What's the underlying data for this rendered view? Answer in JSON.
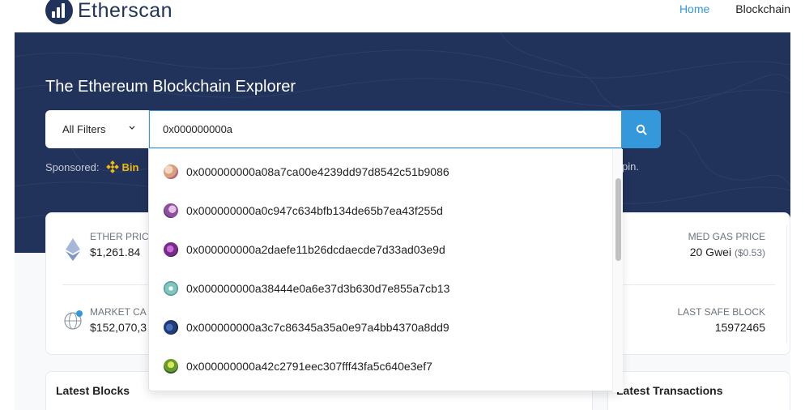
{
  "header": {
    "logo_text": "Etherscan",
    "nav": [
      {
        "label": "Home",
        "active": true
      },
      {
        "label": "Blockchain",
        "active": false
      }
    ]
  },
  "hero": {
    "title": "The Ethereum Blockchain Explorer",
    "filter_label": "All Filters",
    "search_value": "0x000000000a",
    "search_icon": "search-icon",
    "sponsored_label": "Sponsored:",
    "sponsored_brand": "Bin",
    "sponsored_tail": "pin."
  },
  "stats": {
    "ether_price_label": "ETHER PRIC",
    "ether_price_value": "$1,261.84",
    "market_cap_label": "MARKET CA",
    "market_cap_value": "$152,070,3",
    "gas_label": "MED GAS PRICE",
    "gas_value": "20 Gwei",
    "gas_usd": "($0.53)",
    "safe_block_label": "LAST SAFE BLOCK",
    "safe_block_value": "15972465"
  },
  "panels": {
    "latest_blocks": "Latest Blocks",
    "latest_transactions": "Latest Transactions"
  },
  "suggestions": [
    {
      "address": "0x000000000a08a7ca00e4239dd97d8542c51b9086",
      "color": "#d9a07c"
    },
    {
      "address": "0x000000000a0c947c634bfb134de65b7ea43f255d",
      "color": "#8e4f9e"
    },
    {
      "address": "0x000000000a2daefe11b26dcdaecde7d33ad03e9d",
      "color": "#7a2a8c"
    },
    {
      "address": "0x000000000a38444e0a6e37d3b630d7e855a7cb13",
      "color": "#7fc7b8"
    },
    {
      "address": "0x000000000a3c7c86345a35a0e97a4bb4370a8dd9",
      "color": "#1f3b7a"
    },
    {
      "address": "0x000000000a42c2791eec307fff43fa5c640e3ef7",
      "color": "#6a9a2c"
    }
  ],
  "colors": {
    "brand_navy": "#21325b",
    "accent_blue": "#3498db",
    "binance_yellow": "#f0b90b"
  }
}
